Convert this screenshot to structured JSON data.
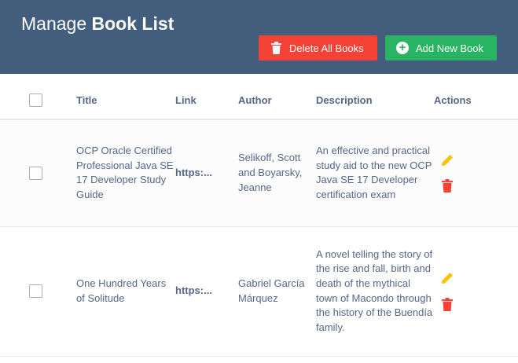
{
  "header": {
    "title_prefix": "Manage",
    "title_bold": "Book List",
    "delete_all_label": "Delete All Books",
    "add_new_label": "Add New Book"
  },
  "table": {
    "columns": [
      "Title",
      "Link",
      "Author",
      "Description",
      "Actions"
    ],
    "rows": [
      {
        "title": "OCP Oracle Certified Professional Java SE 17 Developer Study Guide",
        "link": "https:...",
        "author": "Selikoff, Scott and Boyarsky, Jeanne",
        "description": "An effective and practical study aid to the new OCP Java SE 17 Developer certification exam"
      },
      {
        "title": "One Hundred Years of Solitude",
        "link": "https:...",
        "author": "Gabriel García Márquez",
        "description": "A novel telling the story of the rise and fall, birth and death of the mythical town of Macondo through the history of the Buendía family."
      }
    ]
  },
  "colors": {
    "header_bg": "#435d7d",
    "delete_button": "#f44336",
    "add_button": "#28b463",
    "edit_icon": "#ffc107",
    "delete_icon": "#f44336",
    "text": "#566787"
  },
  "icons": [
    "trash-icon",
    "plus-circle-icon",
    "pencil-icon",
    "checkbox"
  ]
}
